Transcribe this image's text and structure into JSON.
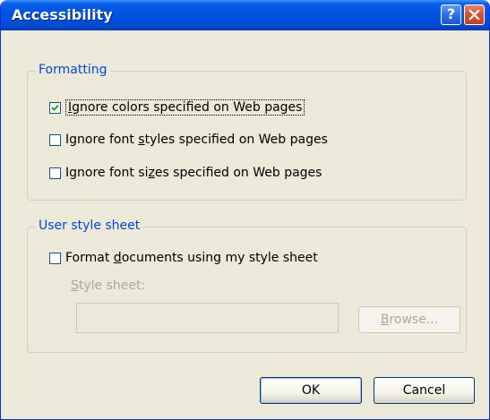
{
  "window": {
    "title": "Accessibility"
  },
  "titlebar": {
    "help_glyph": "?",
    "close_icon": "close-icon"
  },
  "formatting": {
    "legend": "Formatting",
    "options": [
      {
        "pre": "",
        "ul": "I",
        "post": "gnore colors specified on Web pages",
        "checked": true
      },
      {
        "pre": "Ignore font ",
        "ul": "s",
        "post": "tyles specified on Web pages",
        "checked": false
      },
      {
        "pre": "Ignore font si",
        "ul": "z",
        "post": "es specified on Web pages",
        "checked": false
      }
    ]
  },
  "user_style": {
    "legend": "User style sheet",
    "format_option": {
      "pre": "Format ",
      "ul": "d",
      "post": "ocuments using my style sheet",
      "checked": false
    },
    "style_sheet_label": {
      "pre": "",
      "ul": "S",
      "post": "tyle sheet:"
    },
    "style_sheet_value": "",
    "browse": {
      "pre": "",
      "ul": "B",
      "post": "rowse..."
    }
  },
  "buttons": {
    "ok": "OK",
    "cancel": "Cancel"
  },
  "colors": {
    "titlebar": "#0055E5",
    "dialog_bg": "#ECE9D8",
    "group_legend": "#0046D5",
    "check_mark": "#21A121",
    "close_button": "#D5522E"
  }
}
